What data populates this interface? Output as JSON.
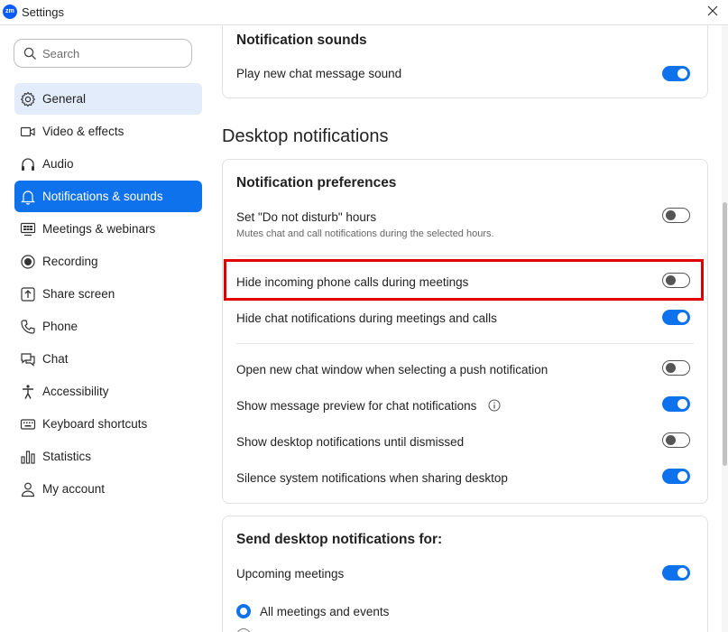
{
  "window": {
    "title": "Settings",
    "logo_text": "zm"
  },
  "search": {
    "placeholder": "Search"
  },
  "sidebar": {
    "items": [
      {
        "label": "General"
      },
      {
        "label": "Video & effects"
      },
      {
        "label": "Audio"
      },
      {
        "label": "Notifications & sounds"
      },
      {
        "label": "Meetings & webinars"
      },
      {
        "label": "Recording"
      },
      {
        "label": "Share screen"
      },
      {
        "label": "Phone"
      },
      {
        "label": "Chat"
      },
      {
        "label": "Accessibility"
      },
      {
        "label": "Keyboard shortcuts"
      },
      {
        "label": "Statistics"
      },
      {
        "label": "My account"
      }
    ],
    "active_item": "Notifications & sounds",
    "hovered_item": "General"
  },
  "notification_sounds": {
    "title": "Notification sounds",
    "play_chat_sound": {
      "label": "Play new chat message sound",
      "on": true
    }
  },
  "desktop_notifications": {
    "heading": "Desktop notifications",
    "preferences": {
      "title": "Notification preferences",
      "dnd": {
        "label": "Set \"Do not disturb\" hours",
        "desc": "Mutes chat and call notifications during the selected hours.",
        "on": false
      },
      "hide_phone_calls": {
        "label": "Hide incoming phone calls during meetings",
        "on": false
      },
      "hide_chat": {
        "label": "Hide chat notifications during meetings and calls",
        "on": true
      },
      "open_chat_window": {
        "label": "Open new chat window when selecting a push notification",
        "on": false
      },
      "message_preview": {
        "label": "Show message preview for chat notifications",
        "on": true
      },
      "until_dismissed": {
        "label": "Show desktop notifications until dismissed",
        "on": false
      },
      "silence_system": {
        "label": "Silence system notifications when sharing desktop",
        "on": true
      }
    },
    "send_for": {
      "title": "Send desktop notifications for:",
      "upcoming_meetings": {
        "label": "Upcoming meetings",
        "on": true
      },
      "all_meetings": {
        "label": "All meetings and events",
        "checked": true
      }
    }
  },
  "colors": {
    "accent": "#0e72ed",
    "highlight": "#e00000",
    "hover": "#e3ecfa"
  }
}
